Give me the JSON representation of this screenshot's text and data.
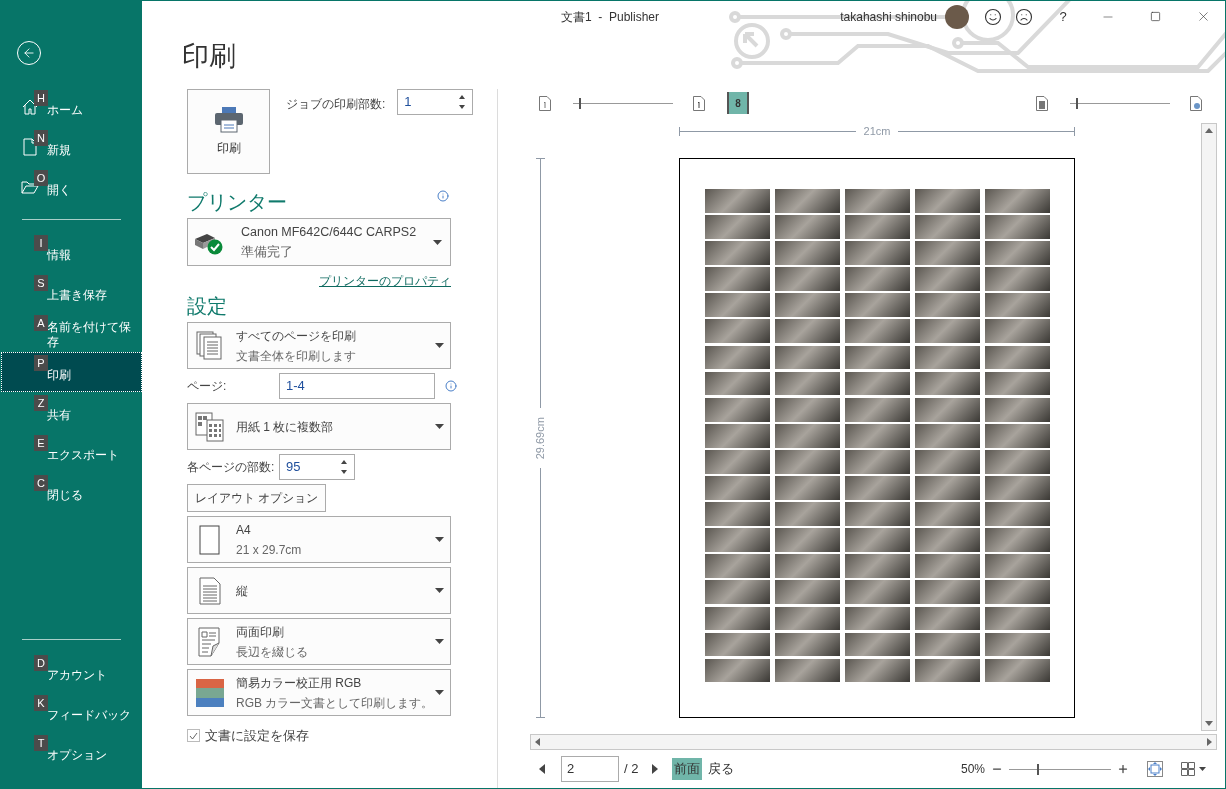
{
  "window": {
    "title": "文書1  -  Publisher",
    "user": "takahashi shinobu",
    "help": "?"
  },
  "sidebar": {
    "sections": [
      {
        "items": [
          {
            "key": "H",
            "label": "ホーム",
            "selected": false
          },
          {
            "key": "N",
            "label": "新規",
            "selected": false
          },
          {
            "key": "O",
            "label": "開く",
            "selected": false
          }
        ]
      },
      {
        "items": [
          {
            "key": "I",
            "label": "情報",
            "selected": false
          },
          {
            "key": "S",
            "label": "上書き保存",
            "selected": false
          },
          {
            "key": "A",
            "label": "名前を付けて保存",
            "selected": false
          },
          {
            "key": "P",
            "label": "印刷",
            "selected": true
          },
          {
            "key": "Z",
            "label": "共有",
            "selected": false
          },
          {
            "key": "E",
            "label": "エクスポート",
            "selected": false
          },
          {
            "key": "C",
            "label": "閉じる",
            "selected": false
          }
        ]
      },
      {
        "items": [
          {
            "key": "D",
            "label": "アカウント",
            "selected": false
          },
          {
            "key": "K",
            "label": "フィードバック",
            "selected": false
          },
          {
            "key": "T",
            "label": "オプション",
            "selected": false
          }
        ]
      }
    ]
  },
  "heading": "印刷",
  "print_button": "印刷",
  "job_copies": {
    "label": "ジョブの印刷部数:",
    "value": "1"
  },
  "printer": {
    "heading": "プリンター",
    "name": "Canon MF642C/644C CARPS2",
    "status": "準備完了",
    "properties_link": "プリンターのプロパティ"
  },
  "settings": {
    "heading": "設定",
    "items": [
      {
        "kind": "dropdown",
        "title": "すべてのページを印刷",
        "subtitle": "文書全体を印刷します"
      },
      {
        "kind": "field",
        "label": "ページ:",
        "value": "1-4"
      },
      {
        "kind": "dropdown",
        "title": "用紙 1 枚に複数部"
      },
      {
        "kind": "spinner",
        "label": "各ページの部数:",
        "value": "95"
      },
      {
        "kind": "button",
        "label": "レイアウト オプション"
      },
      {
        "kind": "dropdown",
        "title": "A4",
        "subtitle": "21 x 29.7cm"
      },
      {
        "kind": "dropdown",
        "title": "縦"
      },
      {
        "kind": "dropdown",
        "title": "両面印刷",
        "subtitle": "長辺を綴じる"
      },
      {
        "kind": "dropdown",
        "title": "簡易カラー校正用 RGB",
        "subtitle": "RGB カラー文書として印刷します。"
      },
      {
        "kind": "checkbox",
        "label": "文書に設定を保存",
        "checked": true
      }
    ]
  },
  "preview": {
    "left_slider": {
      "level": 0.06
    },
    "spread_toggle": {
      "label": "8",
      "selected": true
    },
    "right_slider": {
      "level": 0.06
    },
    "width_label": "21cm",
    "height_label": "29.69cm",
    "navigation": {
      "page": "2",
      "total": "/ 2",
      "views": [
        {
          "label": "前面",
          "selected": true
        },
        {
          "label": "戻る",
          "selected": false
        }
      ]
    },
    "zoom": {
      "label": "50%",
      "level": 0.27
    }
  }
}
